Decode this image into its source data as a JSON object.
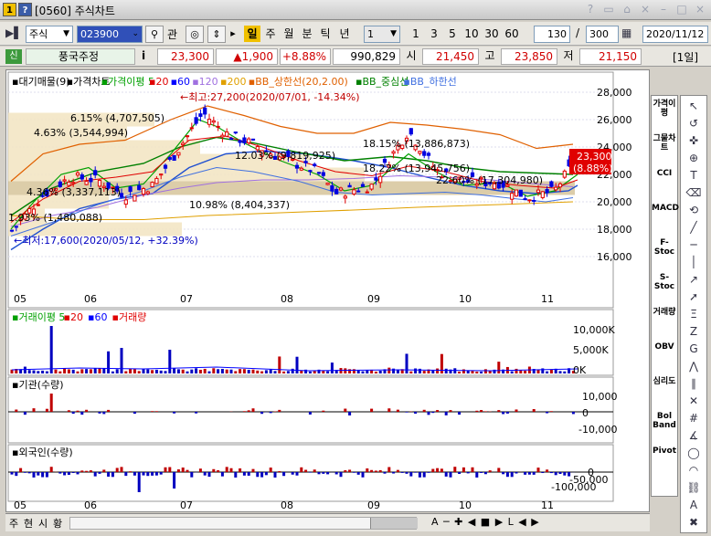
{
  "window": {
    "screen_no": "1",
    "help": "?",
    "title": "[0560] 주식차트",
    "ctl": [
      "?",
      "□",
      "◇",
      "×",
      "?",
      "□",
      "×"
    ]
  },
  "toolbar": {
    "market": "주식",
    "code": "023900",
    "btn_gwan": "관",
    "periods": [
      "일",
      "주",
      "월",
      "분",
      "틱",
      "년"
    ],
    "period_input": "1",
    "nums": [
      "1",
      "3",
      "5",
      "10",
      "30",
      "60"
    ],
    "count": "130",
    "total": "300",
    "date": "2020/11/12"
  },
  "quote": {
    "badge": "신",
    "name": "풍국주정",
    "info": "i",
    "price": "23,300",
    "change": "▲1,900",
    "rate": "+8.88%",
    "volume": "990,829",
    "open_label": "시",
    "open": "21,450",
    "high_label": "고",
    "high": "23,850",
    "low_label": "저",
    "low": "21,150",
    "unit": "[1일]"
  },
  "price_panel": {
    "legend": [
      "▪대기매물(9)",
      "▪가격차트",
      "▪가격이평 5",
      "▪20",
      "▪60",
      "▪120",
      "▪200",
      "▪BB_상한선(20,2.00)",
      "▪BB_중심선",
      "▪BB_하한선"
    ],
    "legend_colors": [
      "#000000",
      "#000000",
      "#00a000",
      "#e00000",
      "#0000ff",
      "#a070e0",
      "#e0a000",
      "#e06000",
      "#008000",
      "#4070e0"
    ],
    "yticks": [
      "28,000",
      "26,000",
      "24,000",
      "22,000",
      "20,000",
      "18,000",
      "16,000"
    ],
    "xticks": [
      "05",
      "06",
      "07",
      "08",
      "09",
      "10",
      "11"
    ],
    "max_note": "←최고:27,200(2020/07/01, -14.34%)",
    "min_note": "←최저:17,600(2020/05/12, +32.39%)",
    "last_price": "23,300",
    "last_rate": "(8.88%)",
    "volume_profile": [
      "6.15% (4,707,505)",
      "4.63% (3,544,994)",
      "12.03% (9,819,925)",
      "18.15% (13,886,873)",
      "18.22% (13,945,756)",
      "22.60% (17,304,980)",
      "4.36% (3,337,113)",
      "1.93% (1,480,088)",
      "10.98% (8,404,337)"
    ]
  },
  "volume_panel": {
    "legend": [
      "▪거래이평 5",
      "▪20",
      "▪60",
      "▪거래량"
    ],
    "yticks": [
      "10,000K",
      "5,000K",
      "0K"
    ]
  },
  "inst_panel": {
    "legend": "▪기관(수량)",
    "yticks": [
      "10,000",
      "0",
      "-10,000"
    ]
  },
  "foreign_panel": {
    "legend": "▪외국인(수량)",
    "yticks": [
      "0",
      "-50,000",
      "-100,000"
    ]
  },
  "indicators": [
    "가격이평",
    "그물차트",
    "CCI",
    "MACD",
    "F-Stoc",
    "S-Stoc",
    "거래량",
    "OBV",
    "심리도",
    "Bol Band",
    "Pivot"
  ],
  "tools": [
    "cursor-tool",
    "reset-tool",
    "cross-tool",
    "zoom-tool",
    "text-tool",
    "eraser-tool",
    "cycle-tool",
    "line-tool",
    "hline-tool",
    "vline-tool",
    "ray-tool",
    "arrow-tool",
    "fibo-tool",
    "z-tool",
    "g-tool",
    "pattern-tool",
    "channel-tool",
    "cross-line-tool",
    "grid-tool",
    "fan-tool",
    "circle-tool",
    "arc-tool",
    "chain-tool",
    "auto-tool",
    "delete-tool"
  ],
  "bottom": {
    "tabs": [
      "주",
      "현",
      "시",
      "황"
    ],
    "right_text": "A ─ ✚ ◀ ■ ▶ L ◀ ▶"
  }
}
